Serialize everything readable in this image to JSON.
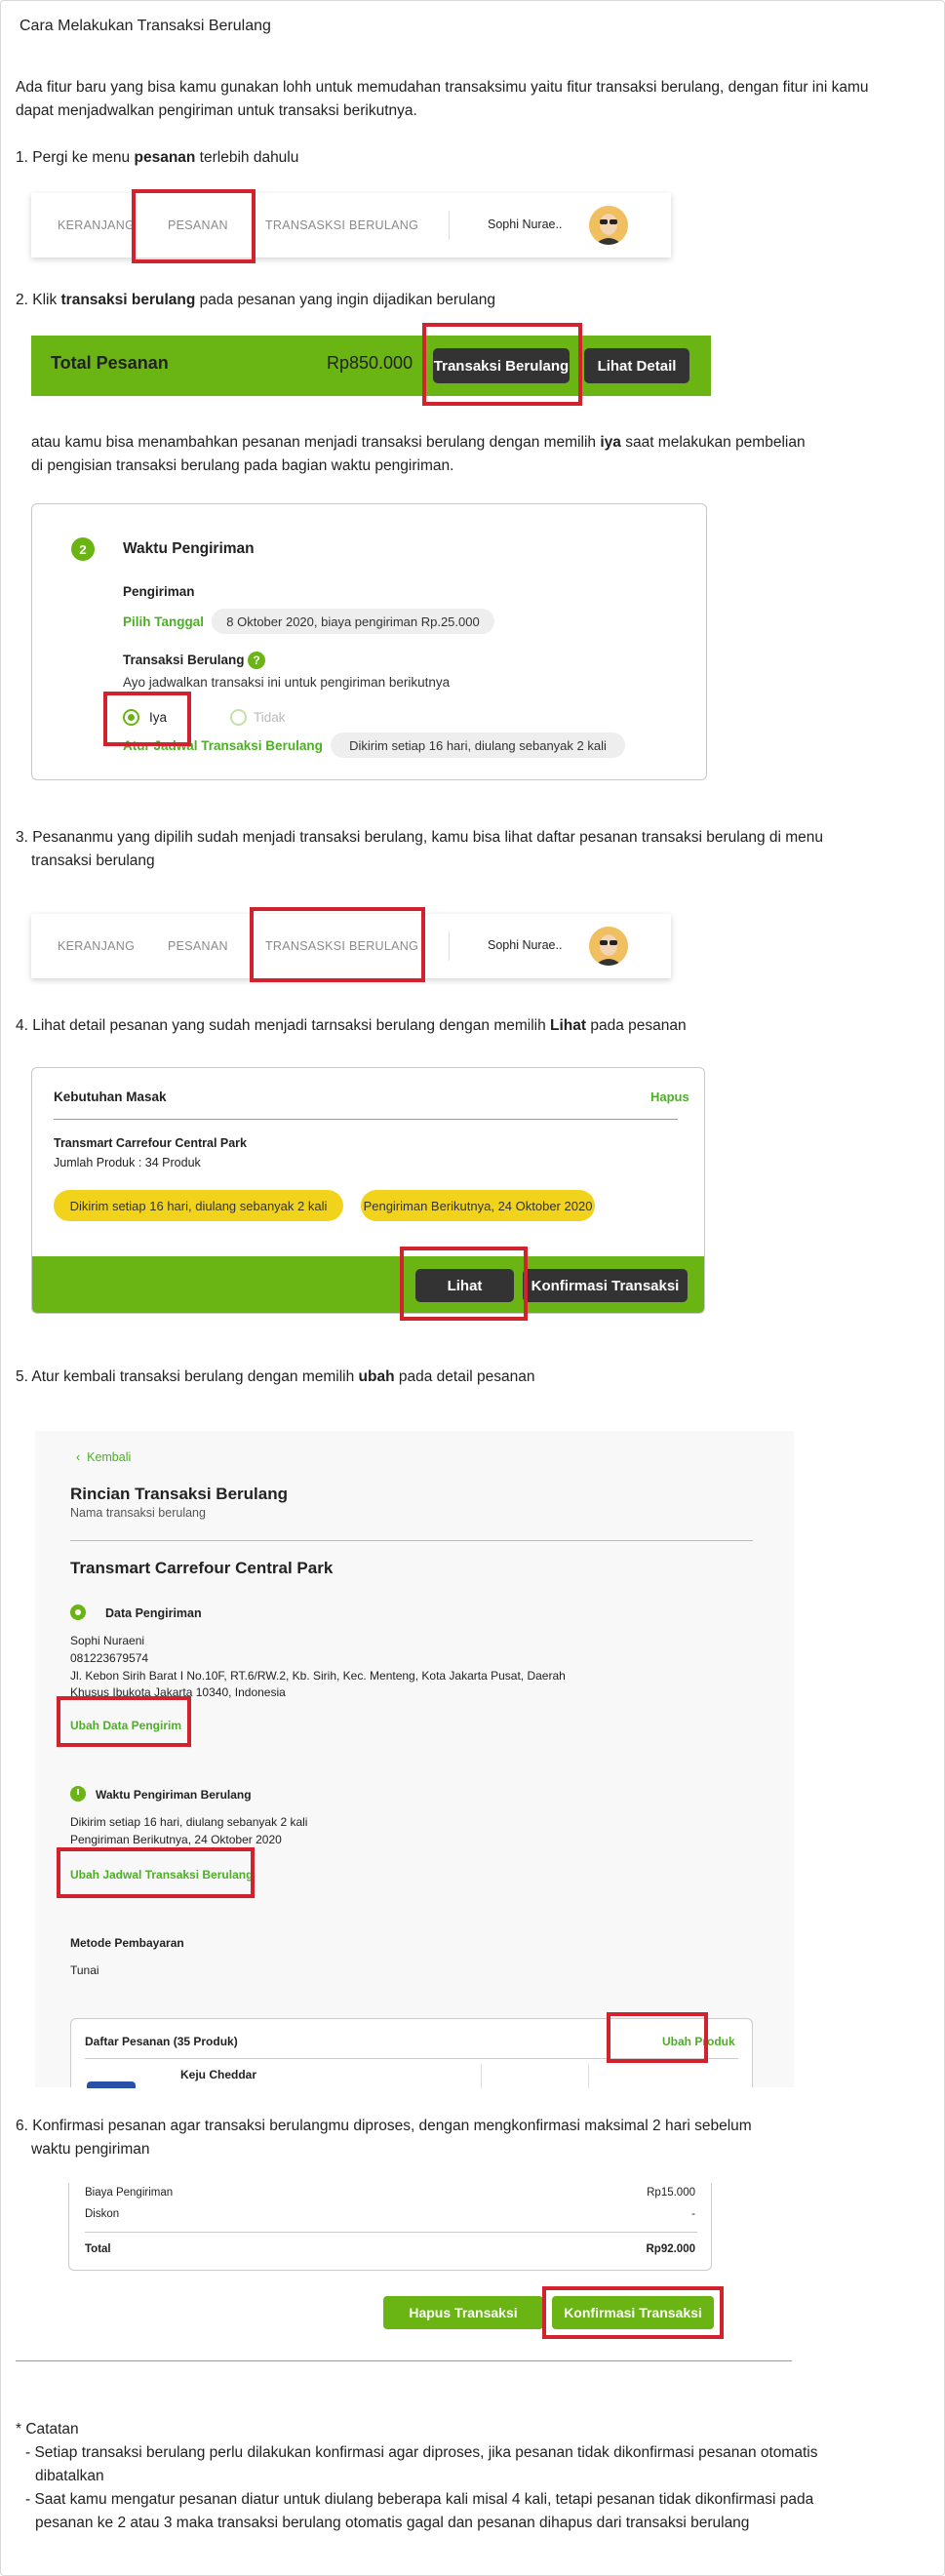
{
  "title": "Cara Melakukan Transaksi Berulang",
  "intro": "Ada fitur baru yang bisa kamu gunakan lohh untuk memudahan transaksimu yaitu fitur transaksi berulang, dengan fitur ini kamu",
  "intro2": "dapat menjadwalkan pengiriman untuk transaksi berikutnya.",
  "step1": {
    "pre": "1. Pergi ke menu ",
    "bold": "pesanan",
    "post": " terlebih dahulu"
  },
  "nav": {
    "tabs": [
      "KERANJANG",
      "PESANAN",
      "TRANSASKSI BERULANG"
    ],
    "user": "Sophi Nurae.."
  },
  "step2": {
    "pre": "2. Klik ",
    "bold": "transaksi berulang",
    "post": " pada pesanan yang ingin dijadikan berulang"
  },
  "order_bar": {
    "label": "Total Pesanan",
    "amount": "Rp850.000",
    "btn_recurring": "Transaksi Berulang",
    "btn_detail": "Lihat Detail"
  },
  "alt": {
    "line1_pre": "atau kamu bisa menambahkan pesanan menjadi transaksi berulang dengan memilih ",
    "line1_bold": "iya",
    "line1_post": " saat melakukan pembelian",
    "line2": "di pengisian transaksi berulang pada bagian waktu pengiriman."
  },
  "shipping": {
    "step_no": "2",
    "heading": "Waktu Pengiriman",
    "pengiriman": "Pengiriman",
    "pick_date": "Pilih Tanggal",
    "date_value": "8 Oktober 2020, biaya pengiriman Rp.25.000",
    "recurring": "Transaksi Berulang",
    "help": "?",
    "hint": "Ayo jadwalkan transaksi ini untuk pengiriman berikutnya",
    "opt_yes": "Iya",
    "opt_no": "Tidak",
    "schedule_link": "Atur Jadwal Transaksi Berulang",
    "schedule_value": "Dikirim setiap 16 hari, diulang sebanyak 2 kali"
  },
  "step3": {
    "line1": "3. Pesananmu yang dipilih sudah menjadi transaksi berulang, kamu bisa lihat daftar pesanan transaksi berulang di menu",
    "line2": "transaksi berulang"
  },
  "step4": {
    "pre": "4. Lihat detail pesanan yang sudah menjadi tarnsaksi berulang dengan memilih ",
    "bold": "Lihat",
    "post": " pada pesanan"
  },
  "recur_card": {
    "name": "Kebutuhan Masak",
    "delete": "Hapus",
    "store": "Transmart Carrefour Central Park",
    "count": "Jumlah Produk : 34 Produk",
    "pill1": "Dikirim setiap 16 hari, diulang sebanyak 2 kali",
    "pill2": "Pengiriman Berikutnya, 24 Oktober 2020",
    "btn_view": "Lihat",
    "btn_confirm": "Konfirmasi Transaksi"
  },
  "step5": {
    "pre": "5. Atur kembali transaksi berulang dengan memilih ",
    "bold": "ubah",
    "post": " pada detail pesanan"
  },
  "detail": {
    "back": "Kembali",
    "title": "Rincian Transaksi Berulang",
    "subtitle": "Nama transaksi berulang",
    "store": "Transmart Carrefour Central Park",
    "ship_data": "Data Pengiriman",
    "name": "Sophi Nuraeni",
    "phone": "081223679574",
    "addr1": "Jl. Kebon Sirih Barat I No.10F, RT.6/RW.2, Kb. Sirih, Kec. Menteng, Kota Jakarta Pusat, Daerah",
    "addr2": "Khusus Ibukota Jakarta 10340, Indonesia",
    "edit_sender": "Ubah Data Pengirim",
    "ship_time": "Waktu Pengiriman Berulang",
    "time1": "Dikirim setiap 16 hari, diulang sebanyak 2 kali",
    "time2": "Pengiriman Berikutnya, 24 Oktober 2020",
    "edit_schedule": "Ubah Jadwal Transaksi Berulang",
    "payment": "Metode Pembayaran",
    "payment_value": "Tunai",
    "order_list": "Daftar Pesanan (35 Produk)",
    "edit_products": "Ubah Produk",
    "product": "Keju Cheddar"
  },
  "step6": {
    "line1": "6. Konfirmasi pesanan agar transaksi berulangmu diproses, dengan mengkonfirmasi maksimal 2 hari sebelum",
    "line2": "waktu pengiriman"
  },
  "summary": {
    "shipping_label": "Biaya Pengiriman",
    "shipping_value": "Rp15.000",
    "discount_label": "Diskon",
    "discount_value": "-",
    "total_label": "Total",
    "total_value": "Rp92.000",
    "btn_delete": "Hapus Transaksi",
    "btn_confirm": "Konfirmasi Transaksi"
  },
  "notes": {
    "heading": "* Catatan",
    "n1a": "- Setiap transaksi berulang perlu dilakukan konfirmasi agar diproses, jika pesanan tidak dikonfirmasi pesanan otomatis",
    "n1b": "dibatalkan",
    "n2a": "- Saat kamu mengatur pesanan diatur untuk diulang beberapa kali misal 4 kali, tetapi pesanan tidak dikonfirmasi pada",
    "n2b": "pesanan ke 2 atau 3 maka transaksi berulang otomatis gagal dan pesanan dihapus dari transaksi berulang"
  },
  "colors": {
    "green": "#6ab414",
    "red": "#d2222d",
    "dark": "#333333",
    "yellow": "#f2d31b"
  }
}
